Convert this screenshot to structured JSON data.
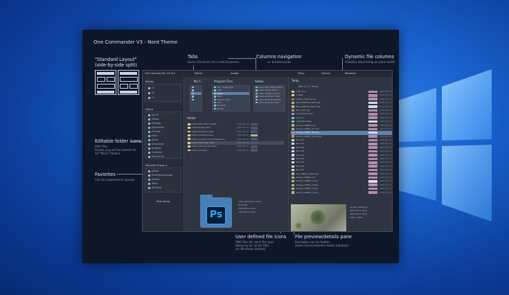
{
  "panel": {
    "title": "One Commander V3 - Nord Theme"
  },
  "callouts": {
    "standard_layout": {
      "title": "\"Standard Layout\"",
      "desc": "(side-by-side split)"
    },
    "tabs": {
      "title": "Tabs",
      "desc": "Same shortcuts as in web browsers"
    },
    "columns_nav": {
      "title": "Columns navigation",
      "desc": "...or breadcrumbs"
    },
    "dynamic_cols": {
      "title": "Dynamic file columns",
      "desc": "Visibility depending on pane width"
    },
    "folder_icons": {
      "title": "Editable folder icons",
      "desc1": "PNG files",
      "desc2": "Shows png will be loaded for",
      "desc3": "all \"Work\" folders"
    },
    "favorites": {
      "title": "Favorites",
      "desc": "Can be organized in groups"
    },
    "user_icons": {
      "title": "User defined file icons",
      "desc1": "PNG files for each file type",
      "desc2": "fallaying for all Art files",
      "desc3": "(or Windows default)"
    },
    "preview": {
      "title": "File preview/details pane",
      "desc1": "Resizable can be hidden",
      "desc2": "Zoom (mousewheel) media playback"
    }
  },
  "app": {
    "window_title": "One Commander V3.X.X",
    "tabs_left": [
      "Media",
      "Adobe"
    ],
    "tabs_right": [
      "Temp",
      "Games",
      "Windows"
    ],
    "sidebar": {
      "drives_header": "Drives",
      "drives": [
        "C:\\",
        "D:\\",
        "E:\\"
      ],
      "home_header": "Home",
      "home_items": [
        "My PC",
        "Videos",
        "Desktop",
        "Documents",
        "Pictures",
        "Music",
        "Home",
        "Downloads",
        "Dropbox",
        "OneDrive",
        "Recycle Bin"
      ],
      "fav_header": "Favorite Group 1",
      "fav_items": [
        "Adobe",
        "Understanding.psd",
        "Games",
        "Temp",
        "Windows"
      ],
      "new_group": "New Group"
    },
    "mid": {
      "col1_head": "My C:",
      "col2_head": "Program Files",
      "col3_head": "Adobe",
      "col2_rows": [
        "100 - Digital Tree",
        "7 Zip",
        "Adobe",
        "AMD",
        "Common Files",
        "Intel",
        "Microsoft",
        "Mozilla"
      ],
      "col3_rows": [
        "Adobe After Effects 2020",
        "Adobe Bridge 2020",
        "Adobe Creative Cloud",
        "Adobe Illustrator 2020",
        "Adobe Photoshop 2020",
        "Adobe Premiere 2020"
      ],
      "sub_head": "Adobe",
      "files": [
        {
          "name": "Adobe After Effects 2020",
          "date": "2020-08-14"
        },
        {
          "name": "Adobe Bridge 2020",
          "date": "2020-08-14"
        },
        {
          "name": "Adobe Illustrator 2020",
          "date": "2020-08-14"
        },
        {
          "name": "Adobe Creative Cloud",
          "date": "2020-08-14"
        },
        {
          "name": "Adobe Creative Cloud Experience",
          "date": "2020-08-14"
        },
        {
          "name": "Adobe Photoshop 2020",
          "date": "2020-08-14"
        },
        {
          "name": "Adobe Premiere Pro 2020",
          "date": "2020-08-14"
        },
        {
          "name": "Adobe Common",
          "date": "2020-08-14"
        }
      ],
      "ps_label": "Ps",
      "details": [
        "Adobe Photoshop 2020",
        "File folder",
        "2020-08-14 10:21",
        "2020-08-14 10:21"
      ]
    },
    "right": {
      "head": "Temp",
      "path": "ABC (C:) > Temp",
      "files": [
        {
          "name": "0 Not cool",
          "size": "",
          "date": "2020-08-14",
          "color": "#ebcb8b"
        },
        {
          "name": "0 dwgs",
          "size": "",
          "date": "2020-08-14",
          "color": "#ebcb8b"
        },
        {
          "name": "bodiles_mytemp.zip",
          "size": "",
          "date": "2020-08-14",
          "color": "#bf616a"
        },
        {
          "name": "DMV_DPNFRX_FILM.mp4",
          "size": "",
          "date": "2020-08-14",
          "color": "#a3be8c"
        },
        {
          "name": "DMV_DPNFRX_FILM.mp4",
          "size": "",
          "date": "2020-08-14",
          "color": "#a3be8c"
        },
        {
          "name": "DSC_1123.jpg",
          "size": "",
          "date": "2020-08-14",
          "color": "#d08770"
        },
        {
          "name": "funfactpedic.png",
          "size": "",
          "date": "2020-08-14",
          "color": "#b48ead"
        },
        {
          "name": "one-icon",
          "size": "",
          "date": "2020-08-14",
          "color": "#88c0d0"
        },
        {
          "name": "oneplotted.dwg",
          "size": "",
          "date": "2020-08-14",
          "color": "#88c0d0"
        },
        {
          "name": "sample_1080p.mp4",
          "size": "",
          "date": "2020-08-14",
          "color": "#a3be8c"
        },
        {
          "name": "sample_1080p_dd.mp4",
          "size": "",
          "date": "2020-08-14",
          "color": "#a3be8c"
        },
        {
          "name": "sample_1080p_360.jpg",
          "size": "",
          "date": "2020-08-14",
          "color": "#d08770"
        },
        {
          "name": "sample_1080p_thumb.jpg",
          "size": "",
          "date": "2020-08-14",
          "color": "#d08770"
        },
        {
          "name": "file 1.txt",
          "size": "",
          "date": "2020-08-14",
          "color": "#d8dee9"
        },
        {
          "name": "file 2.txt",
          "size": "",
          "date": "2020-08-14",
          "color": "#d8dee9"
        },
        {
          "name": "file 3.txt",
          "size": "",
          "date": "2020-08-14",
          "color": "#d8dee9"
        },
        {
          "name": "file 4.txt",
          "size": "",
          "date": "2020-08-14",
          "color": "#d8dee9"
        },
        {
          "name": "file 5.txt",
          "size": "",
          "date": "2020-08-14",
          "color": "#d8dee9"
        },
        {
          "name": "file 6.txt",
          "size": "",
          "date": "2020-08-14",
          "color": "#d8dee9"
        },
        {
          "name": "file 7.txt",
          "size": "",
          "date": "2020-08-14",
          "color": "#d8dee9"
        },
        {
          "name": "file 8.txt",
          "size": "",
          "date": "2020-08-14",
          "color": "#d8dee9"
        },
        {
          "name": "file 9.txt",
          "size": "",
          "date": "2020-08-14",
          "color": "#d8dee9"
        },
        {
          "name": "one_1080p_white.mp4",
          "size": "",
          "date": "2020-08-14",
          "color": "#a3be8c"
        },
        {
          "name": "sample_1080p.mp4",
          "size": "",
          "date": "2020-08-14",
          "color": "#a3be8c"
        },
        {
          "name": "sample_1080p_1.mp4",
          "size": "",
          "date": "2020-08-14",
          "color": "#a3be8c"
        },
        {
          "name": "sample_1080p_2.mp4",
          "size": "",
          "date": "2020-08-14",
          "color": "#a3be8c"
        },
        {
          "name": "sample_1080p_3.mp4",
          "size": "",
          "date": "2020-08-14",
          "color": "#a3be8c"
        },
        {
          "name": "sample_1080p_4.mp4",
          "size": "",
          "date": "2020-08-14",
          "color": "#a3be8c"
        }
      ],
      "pv_info": [
        "sample_1080p.jpg",
        "2020-08-14 10:21",
        "2020-08-14 10:21",
        "1920 x 1080"
      ]
    }
  },
  "colors": {
    "desktop": "#1a64d0",
    "panel": "#0d1727",
    "nord_bg": "#2e3440",
    "accent": "#5e81ac",
    "frost": "#88c0d0"
  }
}
